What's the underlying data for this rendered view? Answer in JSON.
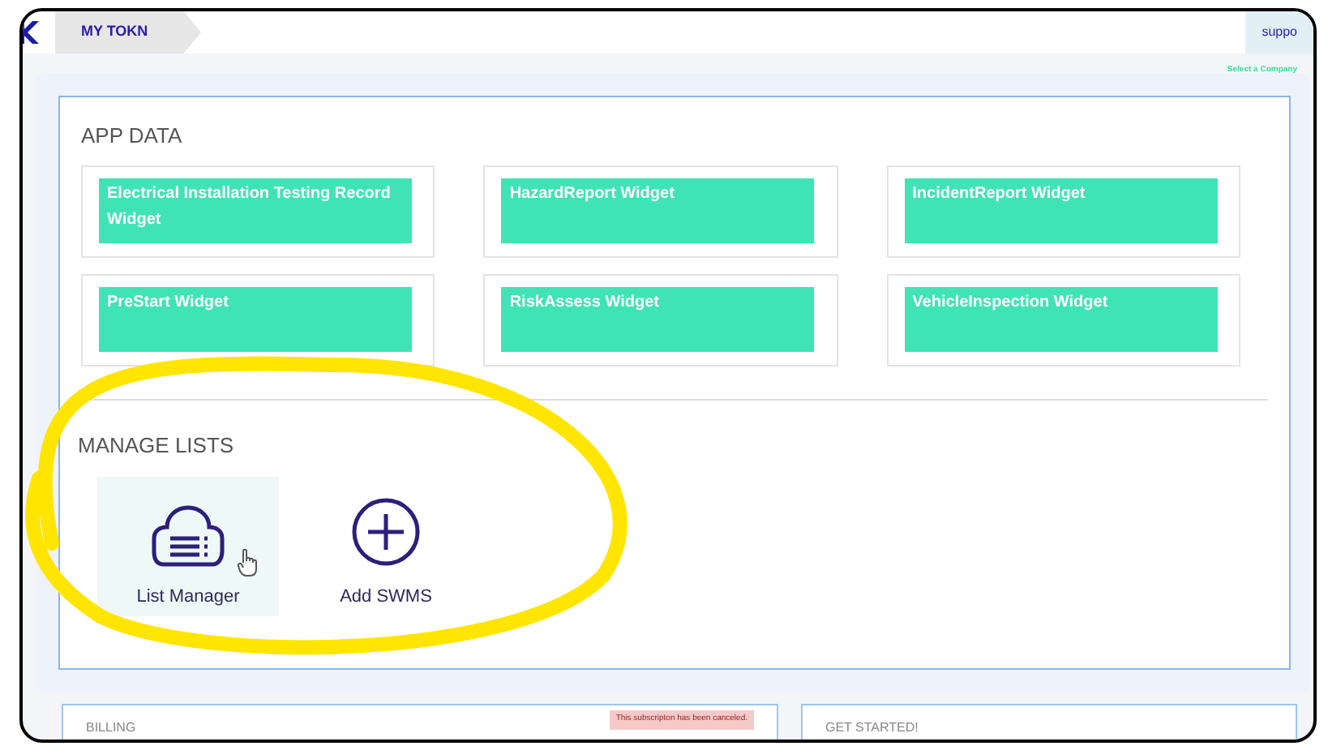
{
  "header": {
    "brand": "MY TOKN",
    "support_link": "suppo",
    "company_label": "Select a Company"
  },
  "app_data": {
    "title": "APP DATA",
    "widgets": [
      {
        "label": "Electrical Installation Testing Record Widget"
      },
      {
        "label": "HazardReport Widget"
      },
      {
        "label": "IncidentReport Widget"
      },
      {
        "label": "PreStart Widget"
      },
      {
        "label": "RiskAssess Widget"
      },
      {
        "label": "VehicleInspection Widget"
      }
    ]
  },
  "manage_lists": {
    "title": "MANAGE LISTS",
    "items": [
      {
        "kind": "list",
        "label": "List Manager",
        "selected": true
      },
      {
        "kind": "add",
        "label": "Add SWMS",
        "selected": false
      }
    ]
  },
  "footer": {
    "billing": "BILLING",
    "notice": "This subscripton has been canceled.",
    "get_started": "GET STARTED!"
  }
}
